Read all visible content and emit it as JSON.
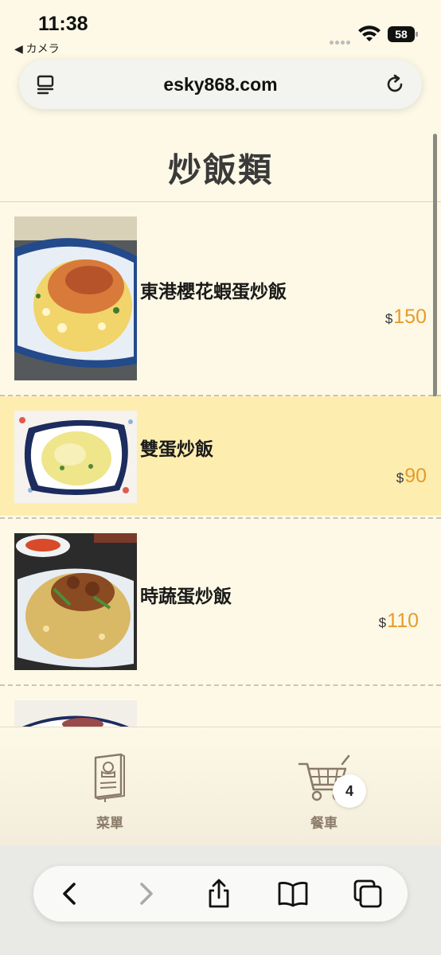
{
  "status_bar": {
    "time": "11:38",
    "back_app": "◀ カメラ",
    "battery": "58"
  },
  "address_bar": {
    "url": "esky868.com",
    "left_icon": "reader-mode-icon",
    "right_icon": "reload-icon"
  },
  "page": {
    "title": "炒飯類"
  },
  "menu_items": [
    {
      "name": "東港櫻花蝦蛋炒飯",
      "currency": "$",
      "price": "150",
      "highlighted": false
    },
    {
      "name": "雙蛋炒飯",
      "currency": "$",
      "price": "90",
      "highlighted": true
    },
    {
      "name": "時蔬蛋炒飯",
      "currency": "$",
      "price": "110",
      "highlighted": false
    }
  ],
  "site_tabbar": {
    "menu_label": "菜單",
    "cart_label": "餐車",
    "cart_count": "4"
  },
  "colors": {
    "background": "#fdf9e6",
    "highlight_row": "#fdeeb0",
    "price_accent": "#e89a2a",
    "tab_label": "#8a7a68"
  },
  "safari_toolbar": {
    "buttons": [
      "back-icon",
      "forward-icon",
      "share-icon",
      "bookmarks-icon",
      "tabs-icon"
    ]
  }
}
